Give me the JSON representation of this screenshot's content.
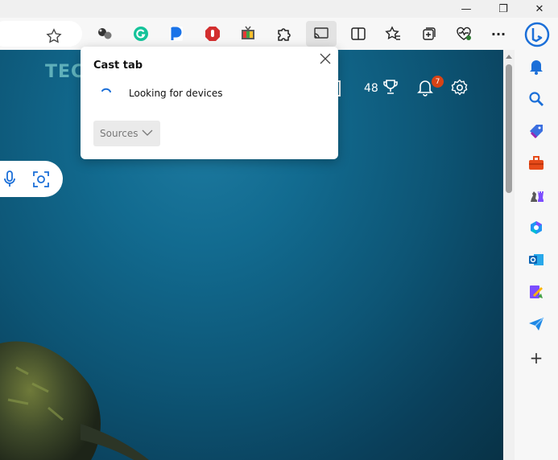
{
  "titlebar": {
    "minimize_glyph": "—",
    "restore_glyph": "❐",
    "close_glyph": "✕"
  },
  "toolbar": {
    "icons": [
      "favorites-star-icon",
      "extension-dots-icon",
      "grammarly-icon",
      "p-extension-icon",
      "stop-sign-icon",
      "tv-extension-icon",
      "extensions-puzzle-icon",
      "cast-icon",
      "split-screen-icon",
      "favorites-icon",
      "collections-icon",
      "browser-essentials-icon",
      "more-icon",
      "bing-icon"
    ],
    "more_label": "···"
  },
  "page": {
    "watermark": "TECHFOLLOWS",
    "rewards_points": "48",
    "notification_count": "7"
  },
  "cast_popup": {
    "title": "Cast tab",
    "status": "Looking for devices",
    "sources_label": "Sources"
  },
  "sidebar": {
    "icons": [
      "bell-icon",
      "search-icon",
      "shopping-tag-icon",
      "tools-icon",
      "games-icon",
      "microsoft365-icon",
      "outlook-icon",
      "drop-icon",
      "send-icon",
      "add-icon"
    ],
    "add_glyph": "+"
  },
  "colors": {
    "ocean_top": "#1d7aa0",
    "ocean_bottom": "#083246",
    "badge": "#d84315",
    "bing_blue": "#1b6fd8"
  }
}
